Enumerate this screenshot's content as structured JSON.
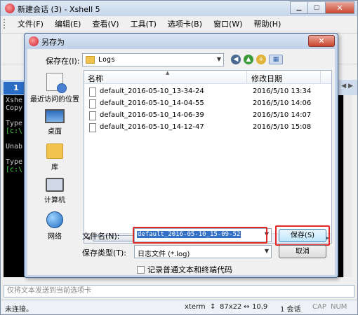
{
  "app": {
    "title": "新建会话 (3) - Xshell 5",
    "menu": [
      "文件(F)",
      "编辑(E)",
      "查看(V)",
      "工具(T)",
      "选项卡(B)",
      "窗口(W)",
      "帮助(H)"
    ],
    "tab_number": "1",
    "terminal_lines": [
      {
        "text": "Xshe",
        "color": "plain"
      },
      {
        "text": "Copy",
        "color": "plain"
      },
      {
        "text": "",
        "color": "plain"
      },
      {
        "text": "Type",
        "color": "plain"
      },
      {
        "text": "[c:\\",
        "color": "green"
      },
      {
        "text": "",
        "color": "plain"
      },
      {
        "text": "Unab",
        "color": "plain"
      },
      {
        "text": "",
        "color": "plain"
      },
      {
        "text": "Type",
        "color": "plain"
      },
      {
        "text": "[c:\\",
        "color": "green"
      }
    ],
    "input_placeholder": "仅将文本发送到当前选项卡",
    "status": {
      "left": "未连接。",
      "term": "xterm",
      "size": "87x22",
      "pos": "10,9",
      "sessions": "1 会话",
      "caps": "CAP",
      "num": "NUM"
    }
  },
  "dialog": {
    "title": "另存为",
    "close_label": "✕",
    "save_in_label": "保存在(I):",
    "save_in_value": "Logs",
    "places": [
      "最近访问的位置",
      "桌面",
      "库",
      "计算机",
      "网络"
    ],
    "columns": {
      "name": "名称",
      "date": "修改日期"
    },
    "files": [
      {
        "name": "default_2016-05-10_13-34-24",
        "date": "2016/5/10 13:34"
      },
      {
        "name": "default_2016-05-10_14-04-55",
        "date": "2016/5/10 14:06"
      },
      {
        "name": "default_2016-05-10_14-06-39",
        "date": "2016/5/10 14:07"
      },
      {
        "name": "default_2016-05-10_14-12-47",
        "date": "2016/5/10 15:08"
      }
    ],
    "file_name_label": "文件名(N):",
    "file_name_value": "default_2016-05-10_15-09-52",
    "file_type_label": "保存类型(T):",
    "file_type_value": "日志文件 (*.log)",
    "save_button": "保存(S)",
    "cancel_button": "取消",
    "checkbox_label": "记录普通文本和终端代码"
  }
}
